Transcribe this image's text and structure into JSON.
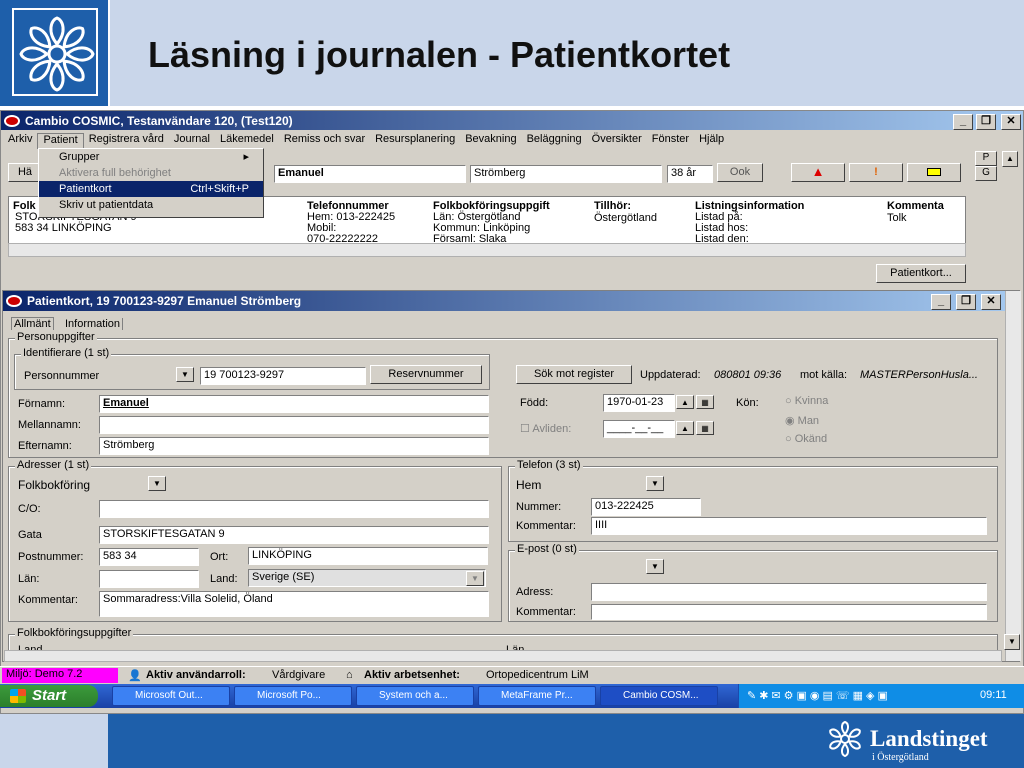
{
  "slide": {
    "title": "Läsning i journalen - Patientkortet",
    "brand": "Landstinget",
    "brand_sub": "i Östergötland"
  },
  "app": {
    "window_title": "Cambio COSMIC, Testanvändare 120, (Test120)",
    "menu": [
      "Arkiv",
      "Patient",
      "Registrera vård",
      "Journal",
      "Läkemedel",
      "Remiss och svar",
      "Resursplanering",
      "Bevakning",
      "Beläggning",
      "Översikter",
      "Fönster",
      "Hjälp"
    ],
    "dropdown": {
      "items": [
        {
          "label": "Grupper",
          "shortcut": "▸"
        },
        {
          "label": "Aktivera full behörighet",
          "shortcut": ""
        },
        {
          "label": "Patientkort",
          "shortcut": "Ctrl+Skift+P"
        },
        {
          "label": "Skriv ut patientdata",
          "shortcut": ""
        }
      ]
    },
    "hamta_label": "Hä",
    "first_name": "Emanuel",
    "last_name": "Strömberg",
    "age": "38 år",
    "ok_label": "Ook",
    "side_p": "P",
    "side_g": "G",
    "list": {
      "headers": [
        "Folk",
        "Telefonnummer",
        "Folkbokföringsuppgift",
        "Tillhör:",
        "Listningsinformation",
        "Kommenta"
      ],
      "col0": [
        "STORSKIFTESGATAN 9",
        "583 34 LINKÖPING"
      ],
      "col1": [
        "Hem: 013-222425",
        "Mobil:",
        "070-22222222"
      ],
      "col2": [
        "Län: Östergötland",
        "Kommun: Linköping",
        "Församl: Slaka"
      ],
      "col3": [
        "Östergötland"
      ],
      "col4": [
        "Listad på:",
        "Listad hos:",
        "Listad den:"
      ],
      "col5": [
        "Tolk"
      ]
    },
    "patientkort_button": "Patientkort..."
  },
  "card": {
    "title": "Patientkort, 19 700123-9297 Emanuel Strömberg",
    "tabs": [
      "Allmänt",
      "Information"
    ],
    "personuppgifter": "Personuppgifter",
    "identifierare": "Identifierare (1 st)",
    "id_type": "Personnummer",
    "id_value": "19 700123-9297",
    "reservnummer_btn": "Reservnummer",
    "sok_btn": "Sök mot register",
    "uppdaterad_lbl": "Uppdaterad:",
    "uppdaterad_val": "080801 09:36",
    "kalla_lbl": "mot källa:",
    "kalla_val": "MASTERPersonHusla...",
    "fornamn_lbl": "Förnamn:",
    "fornamn_val": "Emanuel",
    "mellannamn_lbl": "Mellannamn:",
    "efternamn_lbl": "Efternamn:",
    "efternamn_val": "Strömberg",
    "fodd_lbl": "Född:",
    "fodd_val": "1970-01-23",
    "avliden_lbl": "Avliden:",
    "avliden_val": "____-__-__",
    "kon_lbl": "Kön:",
    "kon_opts": [
      "Kvinna",
      "Man",
      "Okänd"
    ],
    "adresser": "Adresser (1 st)",
    "adr_type": "Folkbokföring",
    "co_lbl": "C/O:",
    "gata_lbl": "Gata",
    "gata_val": "STORSKIFTESGATAN 9",
    "postnr_lbl": "Postnummer:",
    "postnr_val": "583 34",
    "ort_lbl": "Ort:",
    "ort_val": "LINKÖPING",
    "lan_lbl": "Län:",
    "land_lbl": "Land:",
    "land_val": "Sverige (SE)",
    "kommentar_lbl": "Kommentar:",
    "kommentar_val": "Sommaradress:Villa Solelid, Öland",
    "telefon": "Telefon (3 st)",
    "tel_type": "Hem",
    "nummer_lbl": "Nummer:",
    "nummer_val": "013-222425",
    "tel_kommentar_lbl": "Kommentar:",
    "tel_kommentar_val": "IIII",
    "epost": "E-post (0 st)",
    "adress_lbl": "Adress:",
    "epost_kommentar_lbl": "Kommentar:",
    "folkbok_group": "Folkbokföringsuppgifter",
    "land_cut": "Land",
    "lan_cut": "Län"
  },
  "status": {
    "miljo": "Miljö: Demo 7.2",
    "roll_lbl": "Aktiv användarroll:",
    "roll_val": "Vårdgivare",
    "enhet_lbl": "Aktiv arbetsenhet:",
    "enhet_val": "Ortopedicentrum LiM"
  },
  "taskbar": {
    "start": "Start",
    "tasks": [
      "Microsoft Out...",
      "Microsoft Po...",
      "System och a...",
      "MetaFrame Pr...",
      "Cambio COSM..."
    ],
    "clock": "09:11"
  },
  "colors": {
    "slide_blue": "#1e5faa",
    "slide_light": "#c9d6ea",
    "xp_taskbar": "#245edb",
    "miljo_bg": "#ff00ff"
  }
}
